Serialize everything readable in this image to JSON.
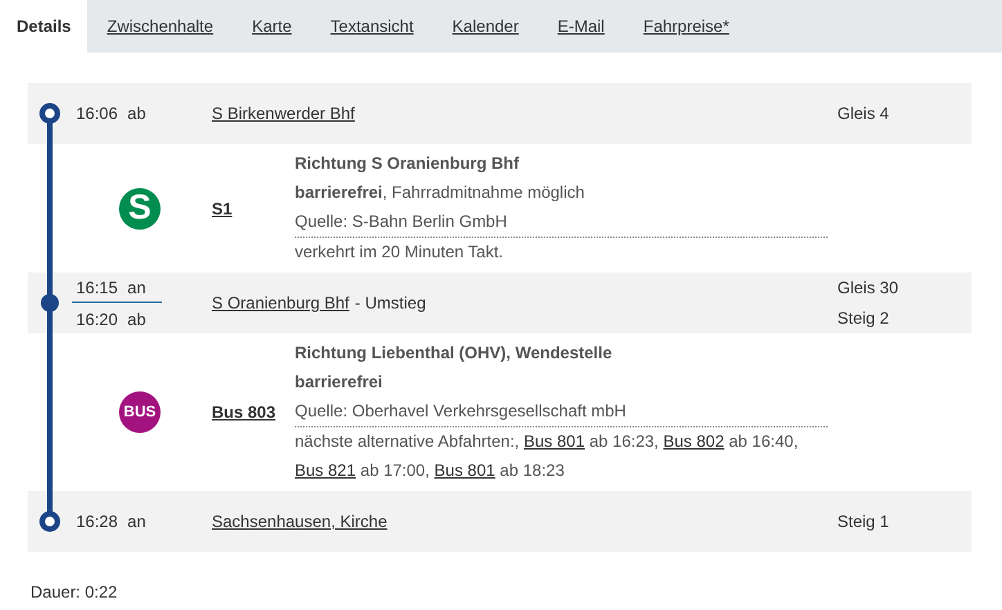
{
  "tabs": [
    {
      "label": "Details",
      "selected": true
    },
    {
      "label": "Zwischenhalte",
      "selected": false
    },
    {
      "label": "Karte",
      "selected": false
    },
    {
      "label": "Textansicht",
      "selected": false
    },
    {
      "label": "Kalender",
      "selected": false
    },
    {
      "label": "E-Mail",
      "selected": false
    },
    {
      "label": "Fahrpreise*",
      "selected": false
    }
  ],
  "timeline": [
    {
      "kind": "stop",
      "endpoint": true,
      "times": [
        {
          "time": "16:06",
          "type": "ab"
        }
      ],
      "station": "S Birkenwerder Bhf",
      "platforms": [
        "Gleis 4"
      ]
    },
    {
      "kind": "leg",
      "badge": "S",
      "color": "#008d4f",
      "line": "S1",
      "direction": "Richtung S Oranienburg Bhf",
      "features": "**barrierefrei**, Fahrradmitnahme möglich",
      "source": "Quelle: S-Bahn Berlin GmbH",
      "notes": [
        {
          "text": "verkehrt im 20 Minuten Takt.",
          "link": false
        }
      ]
    },
    {
      "kind": "stop",
      "endpoint": false,
      "times": [
        {
          "time": "16:15",
          "type": "an"
        },
        {
          "time": "16:20",
          "type": "ab"
        }
      ],
      "station": "S Oranienburg Bhf",
      "suffix": "- Umstieg",
      "platforms": [
        "Gleis 30",
        "Steig 2"
      ]
    },
    {
      "kind": "leg",
      "badge": "BUS",
      "color": "#a3137f",
      "line": "Bus 803",
      "direction": "Richtung Liebenthal (OHV), Wendestelle",
      "features": "**barrierefrei**",
      "source": "Quelle: Oberhavel Verkehrsgesellschaft mbH",
      "notes": [
        {
          "text": "nächste alternative Abfahrten:,",
          "link": false
        },
        {
          "text": "Bus 801",
          "link": true
        },
        {
          "text": "ab 16:23,",
          "link": false
        },
        {
          "text": "Bus 802",
          "link": true
        },
        {
          "text": "ab 16:40,",
          "link": false
        },
        {
          "text": "Bus 821",
          "link": true
        },
        {
          "text": "ab 17:00,",
          "link": false
        },
        {
          "text": "Bus 801",
          "link": true
        },
        {
          "text": "ab 18:23",
          "link": false
        }
      ]
    },
    {
      "kind": "stop",
      "endpoint": true,
      "times": [
        {
          "time": "16:28",
          "type": "an"
        }
      ],
      "station": "Sachsenhausen, Kirche",
      "platforms": [
        "Steig 1"
      ]
    }
  ],
  "duration": "Dauer: 0:22"
}
